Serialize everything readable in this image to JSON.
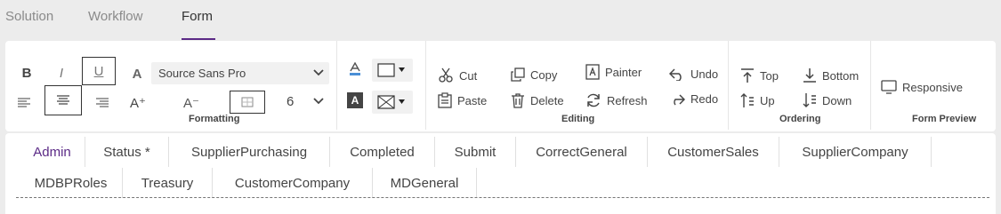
{
  "topnav": {
    "tabs": [
      "Solution",
      "Workflow",
      "Form"
    ],
    "active": "Form"
  },
  "ribbon": {
    "formatting": {
      "label": "Formatting",
      "bold": "B",
      "italic": "I",
      "underline": "U",
      "font_family": "Source Sans Pro",
      "font_size": "6",
      "grow_font": "A⁺",
      "shrink_font": "A⁻"
    },
    "editing": {
      "label": "Editing",
      "cut": "Cut",
      "copy": "Copy",
      "painter": "Painter",
      "undo": "Undo",
      "paste": "Paste",
      "delete": "Delete",
      "refresh": "Refresh",
      "redo": "Redo"
    },
    "ordering": {
      "label": "Ordering",
      "top": "Top",
      "bottom": "Bottom",
      "up": "Up",
      "down": "Down"
    },
    "form_preview": {
      "label": "Form Preview",
      "responsive": "Responsive"
    }
  },
  "form_tabs": {
    "row1": [
      "Admin",
      "Status *",
      "SupplierPurchasing",
      "Completed",
      "Submit",
      "CorrectGeneral",
      "CustomerSales",
      "SupplierCompany"
    ],
    "row2": [
      "MDBPRoles",
      "Treasury",
      "CustomerCompany",
      "MDGeneral"
    ],
    "active": "Admin"
  },
  "colors": {
    "accent": "#5b2a86",
    "background": "#ececec"
  }
}
